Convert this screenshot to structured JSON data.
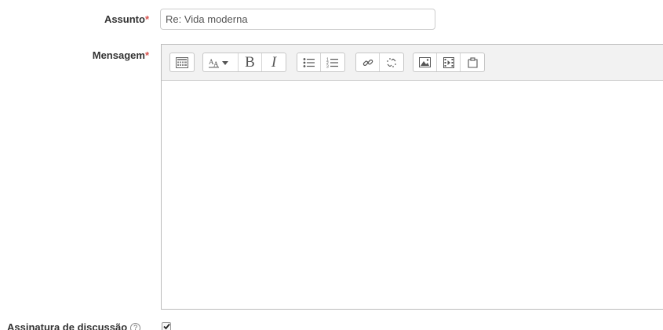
{
  "form": {
    "subject": {
      "label": "Assunto",
      "required_marker": "*",
      "value": "Re: Vida moderna"
    },
    "message": {
      "label": "Mensagem",
      "required_marker": "*",
      "toolbar": {
        "groups": [
          [
            "toolbar-toggle-icon"
          ],
          [
            "font-style-dropdown-icon",
            "bold-icon",
            "italic-icon"
          ],
          [
            "unordered-list-icon",
            "ordered-list-icon"
          ],
          [
            "link-icon",
            "unlink-icon"
          ],
          [
            "image-icon",
            "media-icon",
            "manage-files-icon"
          ]
        ],
        "bold_glyph": "B",
        "italic_glyph": "I"
      },
      "content": ""
    },
    "signature": {
      "label": "Assinatura de discussão",
      "help_glyph": "?",
      "checked": true
    }
  },
  "colors": {
    "required": "#d9534f",
    "toolbar_bg": "#f2f2f2",
    "border": "#cccccc"
  }
}
